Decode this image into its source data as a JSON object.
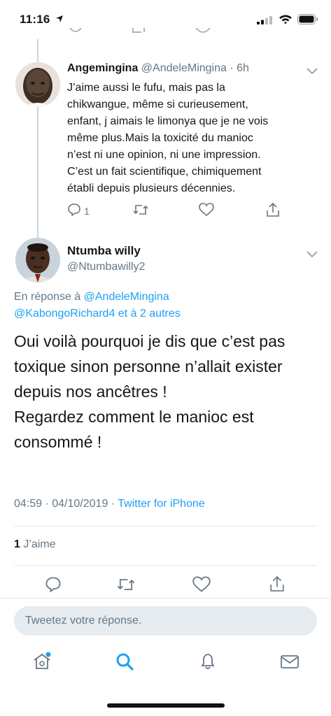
{
  "status_bar": {
    "time": "11:16"
  },
  "reply_tweet": {
    "name": "Angemingina",
    "handle": "@AndeleMingina",
    "age": "· 6h",
    "lines": [
      "J’aime aussi le fufu, mais pas la",
      "chikwangue, même si curieusement,",
      "enfant, j aimais le limonya que je ne vois",
      "même plus.Mais la toxicité du manioc",
      "n’est ni une opinion, ni une impression.",
      "C’est un fait scientifique, chimiquement",
      "établi depuis plusieurs décennies."
    ],
    "reply_count": "1"
  },
  "main_tweet": {
    "name": "Ntumba willy",
    "handle": "@Ntumbawilly2",
    "reply_prefix": "En réponse à ",
    "reply_link1": "@AndeleMingina",
    "reply_link2": "@KabongoRichard4",
    "reply_suffix": " et à 2 autres",
    "lines": [
      "Oui voilà pourquoi je dis que c’est pas",
      "toxique sinon personne n’allait exister",
      "depuis nos ancêtres !",
      "Regardez comment le manioc est",
      "consommé !"
    ],
    "timestamp": "04:59 · 04/10/2019 · ",
    "source": "Twitter for iPhone",
    "like_count": "1",
    "like_label": " J’aime"
  },
  "compose": {
    "placeholder": "Tweetez votre réponse."
  },
  "tabs": [
    "home-icon",
    "search-icon",
    "notifications-icon",
    "messages-icon"
  ],
  "colors": {
    "accent": "#1da1f2",
    "secondary_text": "#657786",
    "divider": "#e1e8ed"
  }
}
